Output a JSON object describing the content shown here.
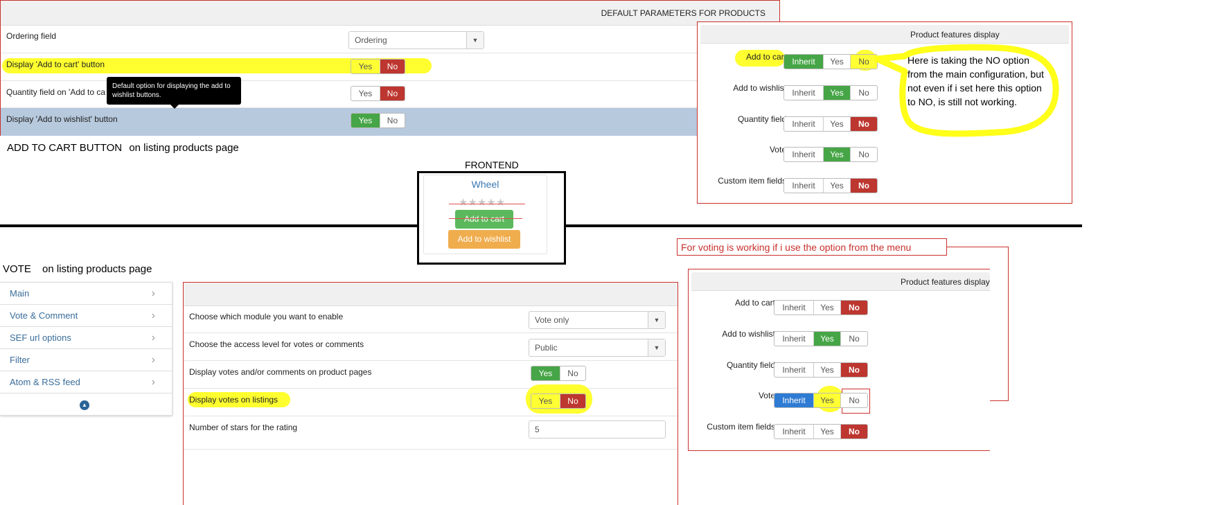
{
  "top_panel": {
    "header": "DEFAULT PARAMETERS FOR PRODUCTS",
    "rows": [
      {
        "label": "Ordering field",
        "select": "Ordering"
      },
      {
        "label": "Display 'Add to cart' button",
        "yes": "Yes",
        "no": "No"
      },
      {
        "label": "Quantity field on 'Add to ca",
        "yes": "Yes",
        "no": "No"
      },
      {
        "label": "Display 'Add to wishlist' button",
        "yes": "Yes",
        "no": "No"
      }
    ],
    "tooltip": "Default option for displaying the add to wishlist buttons."
  },
  "captions": {
    "add_to_cart_a": "ADD TO CART BUTTON",
    "add_to_cart_b": "on listing products page",
    "vote_a": "VOTE",
    "vote_b": "on listing products page",
    "frontend": "FRONTEND",
    "voting_note": "For voting is working if i use the option from the menu",
    "callout": "Here is taking the NO option from the main configuration, but not even if i set here this option to NO, is still not working."
  },
  "features_top": {
    "title": "Product features display",
    "rows": [
      {
        "label": "Add to cart",
        "inherit": "Inherit",
        "yes": "Yes",
        "no": "No"
      },
      {
        "label": "Add to wishlist",
        "inherit": "Inherit",
        "yes": "Yes",
        "no": "No"
      },
      {
        "label": "Quantity field",
        "inherit": "Inherit",
        "yes": "Yes",
        "no": "No"
      },
      {
        "label": "Vote",
        "inherit": "Inherit",
        "yes": "Yes",
        "no": "No"
      },
      {
        "label": "Custom item fields",
        "inherit": "Inherit",
        "yes": "Yes",
        "no": "No"
      }
    ]
  },
  "features_bottom": {
    "title": "Product features display",
    "rows": [
      {
        "label": "Add to cart",
        "inherit": "Inherit",
        "yes": "Yes",
        "no": "No"
      },
      {
        "label": "Add to wishlist",
        "inherit": "Inherit",
        "yes": "Yes",
        "no": "No"
      },
      {
        "label": "Quantity field",
        "inherit": "Inherit",
        "yes": "Yes",
        "no": "No"
      },
      {
        "label": "Vote",
        "inherit": "Inherit",
        "yes": "Yes",
        "no": "No"
      },
      {
        "label": "Custom item fields",
        "inherit": "Inherit",
        "yes": "Yes",
        "no": "No"
      }
    ]
  },
  "product_card": {
    "name": "Wheel",
    "add_to_cart": "Add to cart",
    "add_to_wishlist": "Add to wishlist"
  },
  "sidebar": {
    "items": [
      "Main",
      "Vote & Comment",
      "SEF url options",
      "Filter",
      "Atom & RSS feed"
    ]
  },
  "vote_panel": {
    "rows": [
      {
        "label": "Choose which module you want to enable",
        "select": "Vote only"
      },
      {
        "label": "Choose the access level for votes or comments",
        "select": "Public"
      },
      {
        "label": "Display votes and/or comments on product pages",
        "yes": "Yes",
        "no": "No"
      },
      {
        "label": "Display votes on listings",
        "yes": "Yes",
        "no": "No"
      },
      {
        "label": "Number of stars for the rating",
        "value": "5"
      }
    ]
  },
  "colors": {
    "green": "#46a546",
    "red": "#bd362f",
    "blue": "#2f7bd4",
    "highlight": "#ffff1a"
  }
}
